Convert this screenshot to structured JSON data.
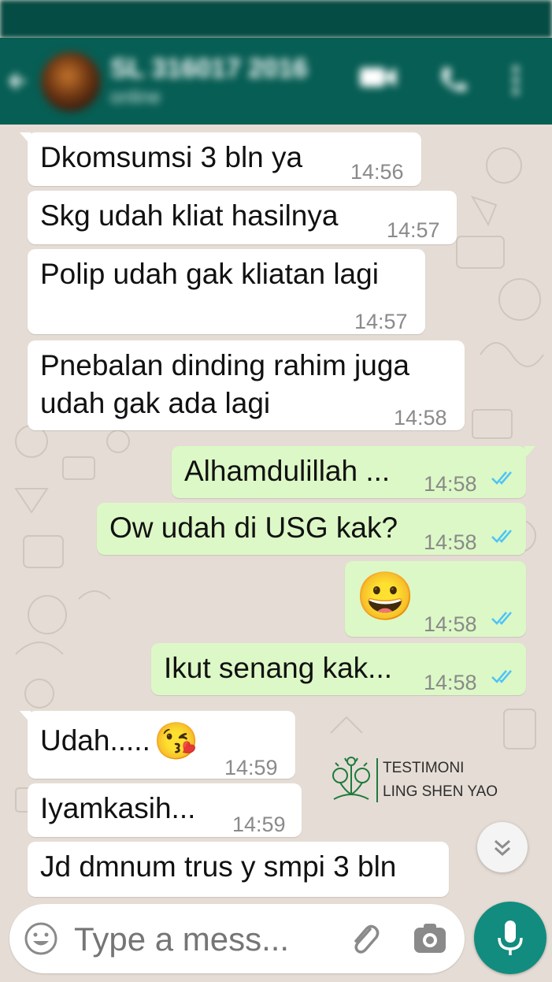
{
  "header": {
    "contact_name": "SL 316017 2016",
    "contact_status": "online",
    "back_icon": "arrow-back-icon",
    "video_icon": "video-call-icon",
    "call_icon": "phone-icon",
    "menu_icon": "more-vert-icon"
  },
  "messages": [
    {
      "dir": "in",
      "text": "Dkomsumsi 3 bln ya",
      "time": "14:56"
    },
    {
      "dir": "in",
      "text": "Skg udah kliat hasilnya",
      "time": "14:57"
    },
    {
      "dir": "in",
      "text": "Polip udah gak kliatan lagi",
      "time": "14:57"
    },
    {
      "dir": "in",
      "text_line1": "Pnebalan dinding rahim juga",
      "text_line2": "udah gak ada lagi",
      "time": "14:58"
    },
    {
      "dir": "out",
      "text": "Alhamdulillah ...",
      "time": "14:58",
      "status": "read"
    },
    {
      "dir": "out",
      "text": "Ow udah di USG kak?",
      "time": "14:58",
      "status": "read"
    },
    {
      "dir": "out",
      "emoji": "😀",
      "time": "14:58",
      "status": "read"
    },
    {
      "dir": "out",
      "text": "Ikut senang kak...",
      "time": "14:58",
      "status": "read"
    },
    {
      "dir": "in",
      "text": "Udah.....",
      "emoji": "😘",
      "time": "14:59"
    },
    {
      "dir": "in",
      "text": "Iyamkasih...",
      "time": "14:59"
    },
    {
      "dir": "in",
      "text": "Jd dmnum trus y smpi 3 bln"
    }
  ],
  "watermark": {
    "line1": "TESTIMONI",
    "line2": "LING SHEN YAO"
  },
  "composer": {
    "placeholder": "Type a mess...",
    "emoji_icon": "emoji-icon",
    "attach_icon": "paperclip-icon",
    "camera_icon": "camera-icon",
    "mic_icon": "mic-icon"
  },
  "scroll_icon": "chevron-double-down-icon",
  "colors": {
    "header": "#075e54",
    "incoming_bubble": "#ffffff",
    "outgoing_bubble": "#dcf8c6",
    "read_tick": "#4fc3f7",
    "mic_button": "#128c7e"
  }
}
